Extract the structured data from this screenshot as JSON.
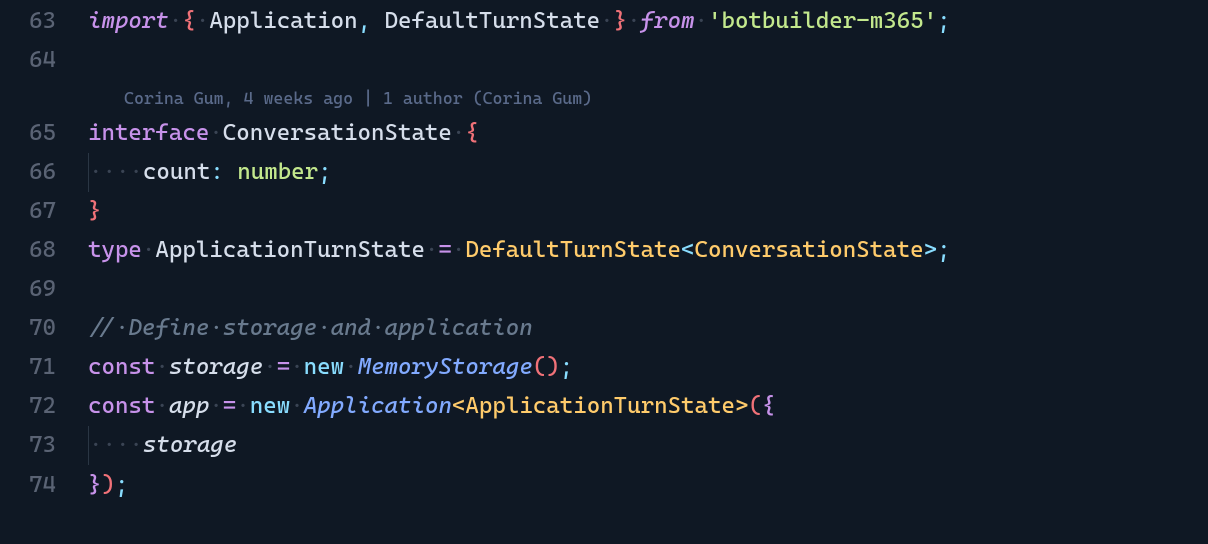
{
  "annotation": "Corina Gum, 4 weeks ago | 1 author (Corina Gum)",
  "lines": {
    "63": {
      "num": "63",
      "import_kw": "import",
      "app": "Application",
      "dts": "DefaultTurnState",
      "from_kw": "from",
      "pkg": "'botbuilder-m365'",
      "brace_o": "{",
      "brace_c": "}",
      "semi": ";",
      "dot": "·",
      "comma": ",",
      "sp": " "
    },
    "64": {
      "num": "64"
    },
    "65": {
      "num": "65",
      "interface_kw": "interface",
      "name": "ConversationState",
      "brace_o": "{",
      "dot": "·"
    },
    "66": {
      "num": "66",
      "prop": "count",
      "colon": ":",
      "type": "number",
      "semi": ";",
      "dot4": "····",
      "sp": " "
    },
    "67": {
      "num": "67",
      "brace_c": "}"
    },
    "68": {
      "num": "68",
      "type_kw": "type",
      "name": "ApplicationTurnState",
      "eq": "=",
      "right": "DefaultTurnState",
      "generic": "ConversationState",
      "lt": "<",
      "gt": ">",
      "semi": ";",
      "dot": "·",
      "sp": " "
    },
    "69": {
      "num": "69"
    },
    "70": {
      "num": "70",
      "comment": "//",
      "text": "Define·storage·and·application",
      "dot": "·"
    },
    "71": {
      "num": "71",
      "const_kw": "const",
      "var": "storage",
      "eq": "=",
      "new_kw": "new",
      "cls": "MemoryStorage",
      "po": "(",
      "pc": ")",
      "semi": ";",
      "dot": "·",
      "sp": " "
    },
    "72": {
      "num": "72",
      "const_kw": "const",
      "var": "app",
      "eq": "=",
      "new_kw": "new",
      "cls": "Application",
      "generic": "ApplicationTurnState",
      "lt": "<",
      "gt": ">",
      "po": "(",
      "brace_o": "{",
      "dot": "·",
      "sp": " "
    },
    "73": {
      "num": "73",
      "prop": "storage",
      "dot4": "····"
    },
    "74": {
      "num": "74",
      "brace_c": "}",
      "pc": ")",
      "semi": ";"
    }
  }
}
